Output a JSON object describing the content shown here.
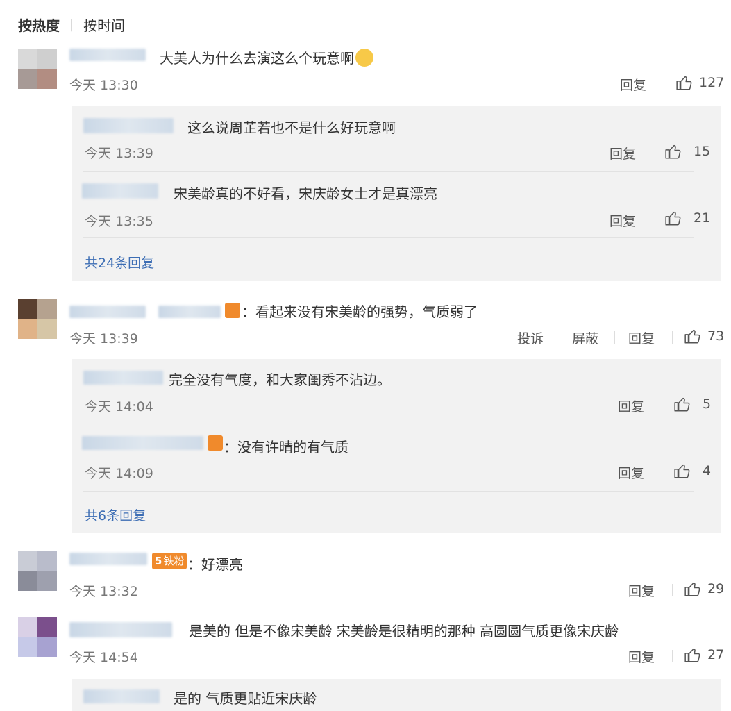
{
  "sort": {
    "hot": "按热度",
    "time": "按时间"
  },
  "comments": [
    {
      "content": "大美人为什么去演这么个玩意啊",
      "time": "今天 13:30",
      "reply": "回复",
      "likes": "127",
      "replies": [
        {
          "content": "这么说周芷若也不是什么好玩意啊",
          "time": "今天 13:39",
          "reply": "回复",
          "likes": "15"
        },
        {
          "content": "宋美龄真的不好看，宋庆龄女士才是真漂亮",
          "time": "今天 13:35",
          "reply": "回复",
          "likes": "21"
        }
      ],
      "more": "共24条回复"
    },
    {
      "content": "：看起来没有宋美龄的强势，气质弱了",
      "time": "今天 13:39",
      "report": "投诉",
      "block": "屏蔽",
      "reply": "回复",
      "likes": "73",
      "replies": [
        {
          "content": "完全没有气度，和大家闺秀不沾边。",
          "time": "今天 14:04",
          "reply": "回复",
          "likes": "5"
        },
        {
          "content": "：没有许晴的有气质",
          "time": "今天 14:09",
          "reply": "回复",
          "likes": "4"
        }
      ],
      "more": "共6条回复"
    },
    {
      "content": "：好漂亮",
      "badge": "铁粉",
      "badge_level": "5",
      "time": "今天 13:32",
      "reply": "回复",
      "likes": "29"
    },
    {
      "content": "是美的 但是不像宋美龄 宋美龄是很精明的那种 高圆圆气质更像宋庆龄",
      "time": "今天 14:54",
      "reply": "回复",
      "likes": "27",
      "replies": [
        {
          "content": "是的 气质更贴近宋庆龄"
        }
      ]
    }
  ],
  "colors": {
    "link": "#3c6db4",
    "reply_bg": "#f2f2f2",
    "badge": "#f08a2c"
  }
}
